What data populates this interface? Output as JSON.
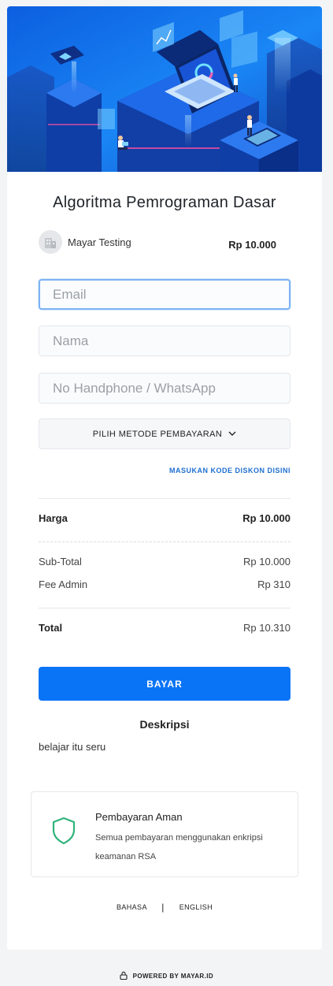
{
  "product": {
    "title": "Algoritma Pemrograman Dasar",
    "seller_name": "Mayar Testing",
    "price": "Rp 10.000"
  },
  "form": {
    "email_placeholder": "Email",
    "name_placeholder": "Nama",
    "phone_placeholder": "No Handphone / WhatsApp",
    "payment_method_label": "PILIH METODE PEMBAYARAN",
    "discount_link": "MASUKAN KODE DISKON DISINI"
  },
  "summary": {
    "harga_label": "Harga",
    "harga_value": "Rp 10.000",
    "subtotal_label": "Sub-Total",
    "subtotal_value": "Rp 10.000",
    "fee_label": "Fee Admin",
    "fee_value": "Rp 310",
    "total_label": "Total",
    "total_value": "Rp 10.310"
  },
  "actions": {
    "pay_label": "BAYAR"
  },
  "description": {
    "title": "Deskripsi",
    "text": "belajar itu seru"
  },
  "secure_box": {
    "title": "Pembayaran Aman",
    "text": "Semua pembayaran menggunakan enkripsi keamanan RSA"
  },
  "language": {
    "label": "BAHASA",
    "separator": "|",
    "current": "ENGLISH"
  },
  "footer": {
    "powered_by": "POWERED BY MAYAR.ID"
  },
  "icons": {
    "seller_avatar": "building-icon",
    "dropdown": "chevron-down-icon",
    "security": "shield-icon",
    "footer": "lock-icon"
  },
  "colors": {
    "primary": "#0a74f6",
    "link": "#1e6fd0",
    "shield": "#2fb37a",
    "hero_blue": "#1a6ef0"
  }
}
